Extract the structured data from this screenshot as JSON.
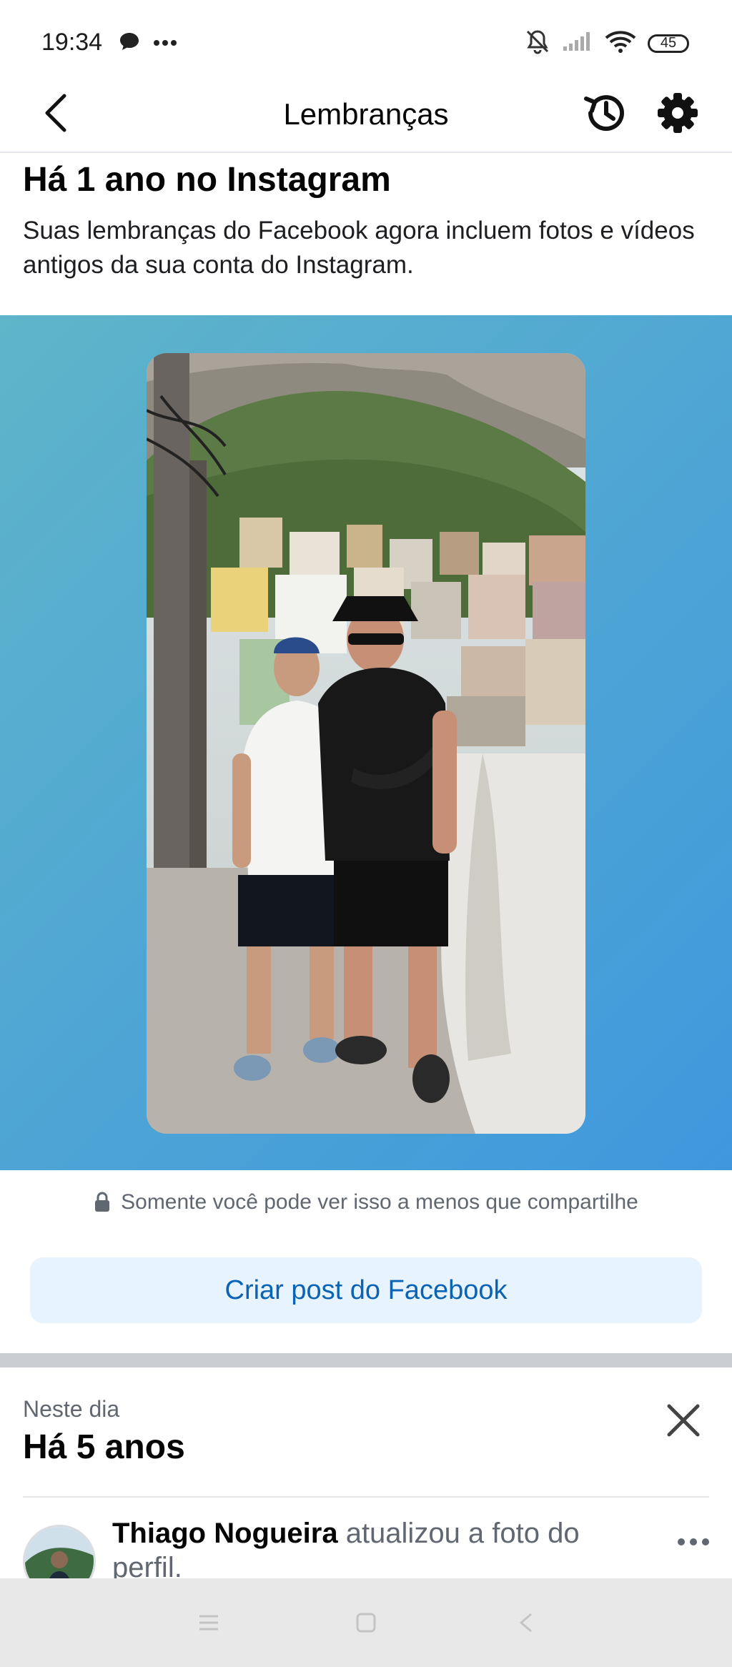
{
  "status_bar": {
    "time": "19:34",
    "battery": "45"
  },
  "header": {
    "title": "Lembranças"
  },
  "intro": {
    "title": "Há 1 ano no Instagram",
    "description": "Suas lembranças do Facebook agora incluem fotos e vídeos antigos da sua conta do Instagram."
  },
  "memory": {
    "privacy_note": "Somente você pode ver isso a menos que compartilhe",
    "create_post_label": "Criar post do Facebook"
  },
  "on_this_day": {
    "label": "Neste dia",
    "title": "Há 5 anos",
    "post": {
      "author": "Thiago Nogueira",
      "action": " atualizou a foto do perfil."
    }
  },
  "colors": {
    "accent": "#0b63b3",
    "button_bg": "#e7f3ff",
    "card_gradient_start": "#5fb5c9",
    "card_gradient_end": "#3f98dd"
  }
}
